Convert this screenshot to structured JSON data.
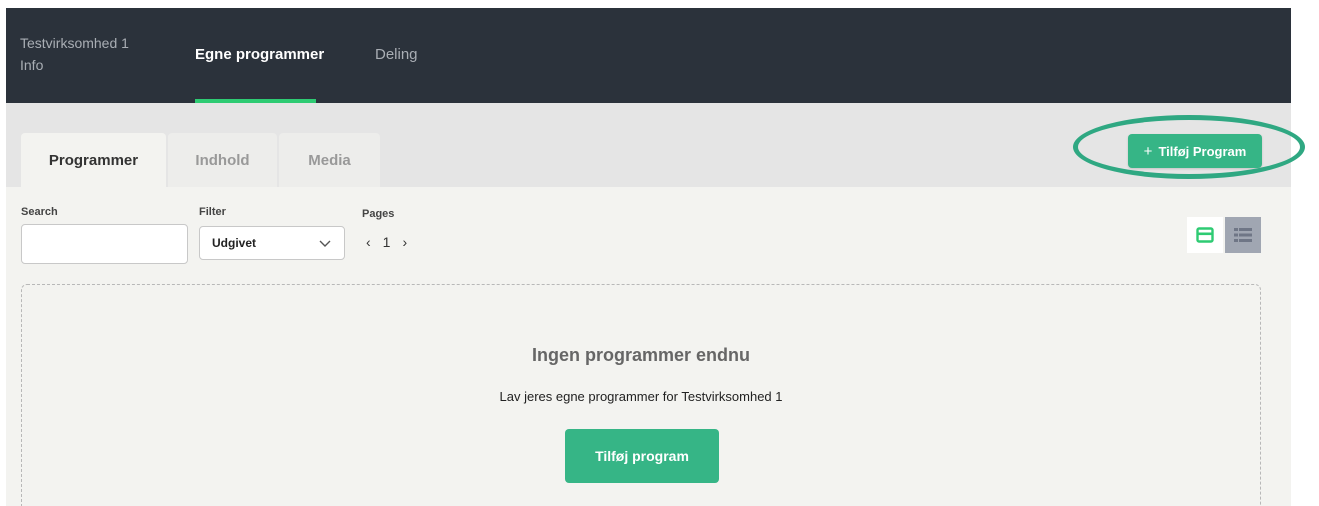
{
  "topnav": {
    "company": "Testvirksomhed 1\nInfo",
    "tabs": [
      {
        "label": "Egne programmer",
        "active": true
      },
      {
        "label": "Deling",
        "active": false
      }
    ]
  },
  "subtabs": [
    {
      "label": "Programmer",
      "active": true
    },
    {
      "label": "Indhold",
      "active": false
    },
    {
      "label": "Media",
      "active": false
    }
  ],
  "add_program_top": {
    "icon": "plus-icon",
    "label": "Tilføj Program"
  },
  "controls": {
    "search_label": "Search",
    "search_value": "",
    "filter_label": "Filter",
    "filter_value": "Udgivet",
    "pages_label": "Pages",
    "current_page": "1"
  },
  "view_toggle": {
    "card_icon": "card-view-icon",
    "list_icon": "list-view-icon"
  },
  "empty_state": {
    "title": "Ingen programmer endnu",
    "description": "Lav jeres egne programmer for Testvirksomhed 1",
    "button": "Tilføj program"
  },
  "colors": {
    "nav_bg": "#2b323b",
    "accent_green": "#36b586",
    "nav_active_underline": "#2ecb73",
    "highlight_ring": "#2fa882"
  }
}
